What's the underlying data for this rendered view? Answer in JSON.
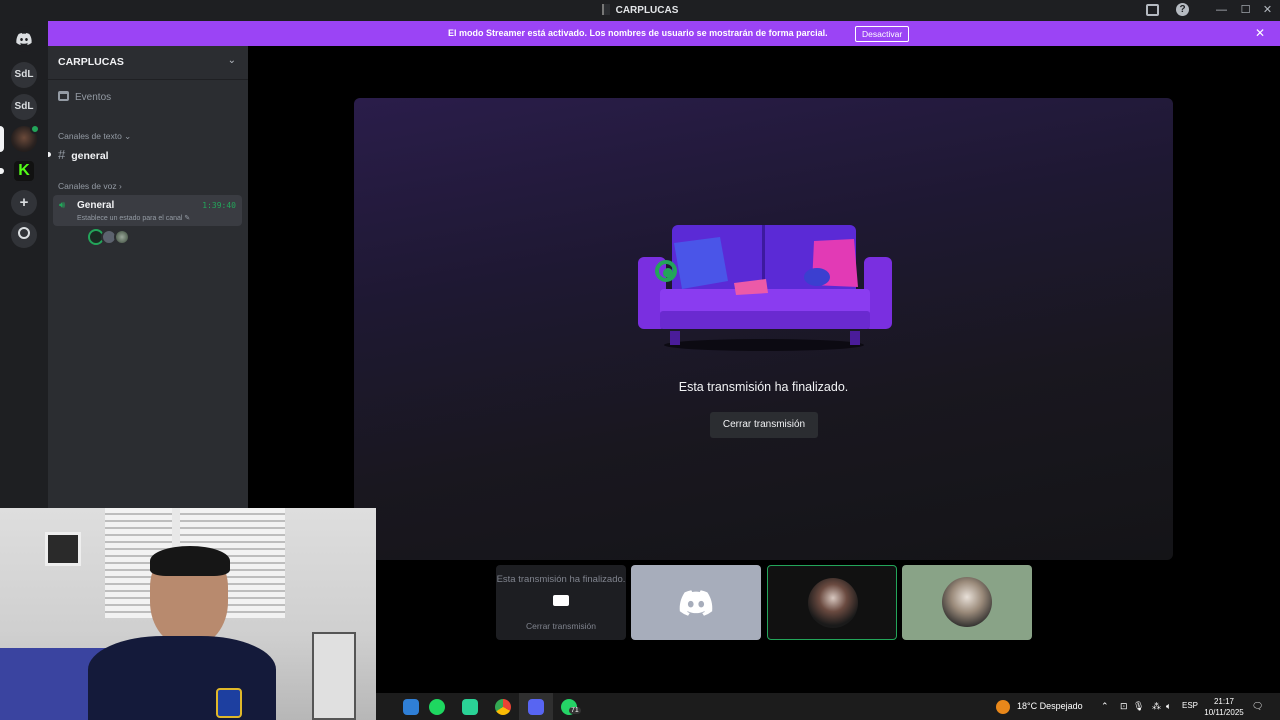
{
  "window": {
    "title": "CARPLUCAS",
    "controls": [
      "inbox-icon",
      "help-icon",
      "minimize-icon",
      "maximize-icon",
      "close-icon"
    ]
  },
  "banner": {
    "message": "El modo Streamer está activado. Los nombres de usuario se mostrarán de forma parcial.",
    "action_label": "Desactivar",
    "close_glyph": "✕",
    "color": "#9b44f5"
  },
  "rail": {
    "items": [
      {
        "label": "",
        "icon": "discord-logo-icon"
      },
      {
        "label": "SdL"
      },
      {
        "label": "SdL"
      },
      {
        "label": "",
        "icon": "server-avatar-icon"
      },
      {
        "label": "K",
        "icon": "kick-icon"
      },
      {
        "label": "+",
        "icon": "add-server-icon"
      },
      {
        "label": "",
        "icon": "discover-icon"
      }
    ]
  },
  "sidebar": {
    "server_name": "CARPLUCAS",
    "events_label": "Eventos",
    "text_category": "Canales de texto",
    "text_channel": "general",
    "voice_category": "Canales de voz",
    "voice_channel": {
      "name": "General",
      "timer": "1:39:40",
      "status_prompt": "Establece un estado para el canal"
    }
  },
  "stream": {
    "ended_message": "Esta transmisión ha finalizado.",
    "close_label": "Cerrar transmisión"
  },
  "tiles": {
    "stream_tile_message": "Esta transmisión ha finalizado.",
    "stream_tile_close": "Cerrar transmisión"
  },
  "taskbar": {
    "weather": "18°C  Despejado",
    "language": "ESP",
    "time": "21:17",
    "date": "10/11/2025",
    "whatsapp_badge": "71"
  },
  "colors": {
    "online": "#23a55a",
    "accent": "#5865f2"
  }
}
